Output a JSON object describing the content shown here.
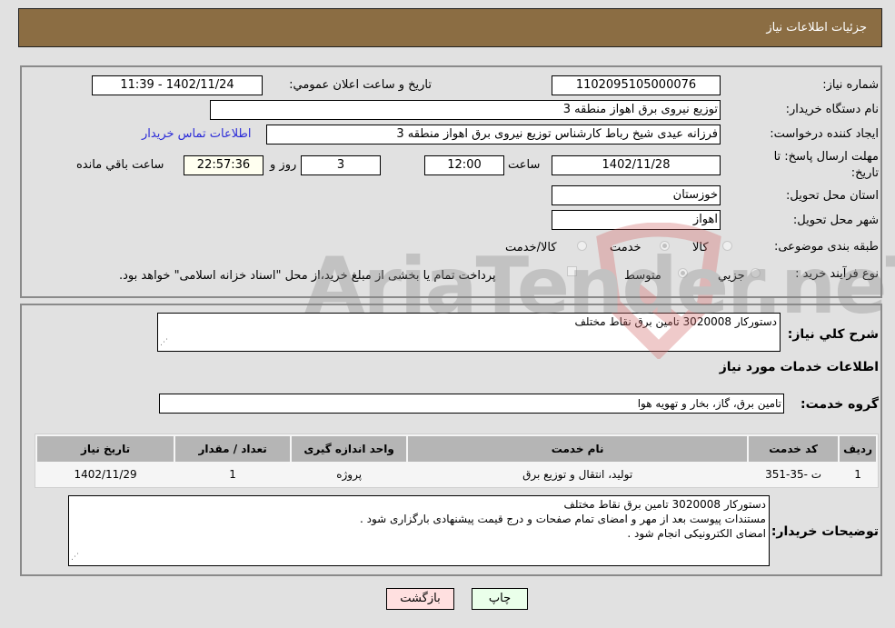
{
  "header": {
    "title": "جزئیات اطلاعات نیاز"
  },
  "form": {
    "need_number": {
      "label": "شماره نیاز:",
      "value": "1102095105000076"
    },
    "announce": {
      "label": "تاریخ و ساعت اعلان عمومي:",
      "value": "1402/11/24 - 11:39"
    },
    "buyer_org": {
      "label": "نام دستگاه خریدار:",
      "value": "توزیع نیروی برق اهواز منطقه 3"
    },
    "requester": {
      "label": "ایجاد کننده درخواست:",
      "value": "فرزانه عیدی شیخ رباط کارشناس توزیع نیروی برق اهواز منطقه 3"
    },
    "contact_link": "اطلاعات تماس خریدار",
    "deadline": {
      "label_line1": "مهلت ارسال پاسخ: تا",
      "label_line2": "تاریخ:",
      "date": "1402/11/28",
      "time_label": "ساعت",
      "time": "12:00",
      "days": "3",
      "days_label": "روز و",
      "remaining": "22:57:36",
      "remaining_label": "ساعت باقي مانده"
    },
    "province": {
      "label": "استان محل تحویل:",
      "value": "خوزستان"
    },
    "city": {
      "label": "شهر محل تحویل:",
      "value": "اهواز"
    },
    "category": {
      "label": "طبقه بندی موضوعی:",
      "options": [
        "کالا",
        "خدمت",
        "کالا/خدمت"
      ],
      "selected": "خدمت"
    },
    "process": {
      "label": "نوع فرآیند خرید :",
      "options": [
        "جزيي",
        "متوسط"
      ],
      "selected": "متوسط",
      "treasury_note": "پرداخت تمام یا بخشی از مبلغ خرید،از محل \"اسناد خزانه اسلامی\" خواهد بود."
    }
  },
  "details": {
    "summary_label": "شرح کلي نياز:",
    "summary_value": "دستورکار 3020008 تامین برق نقاط مختلف",
    "services_heading": "اطلاعات خدمات مورد نياز",
    "service_group_label": "گروه خدمت:",
    "service_group_value": "تامین برق، گاز، بخار و تهویه هوا",
    "table": {
      "columns": [
        "رديف",
        "کد خدمت",
        "نام خدمت",
        "واحد اندازه گیری",
        "تعداد / مقدار",
        "تاریخ نیاز"
      ],
      "rows": [
        [
          "1",
          "ت -35-351",
          "تولید، انتقال و توزیع برق",
          "پروژه",
          "1",
          "1402/11/29"
        ]
      ]
    },
    "buyer_notes_label": "توضیحات خریدار:",
    "buyer_notes": [
      "دستورکار 3020008 تامین برق نقاط مختلف",
      "مستندات پیوست بعد از مهر و امضای تمام صفحات و درج قیمت پیشنهادی بارگزاری شود .",
      "امضای الکترونیکی انجام شود ."
    ]
  },
  "buttons": {
    "print": "چاپ",
    "back": "بازگشت"
  },
  "watermark": "AriaTender.neT"
}
